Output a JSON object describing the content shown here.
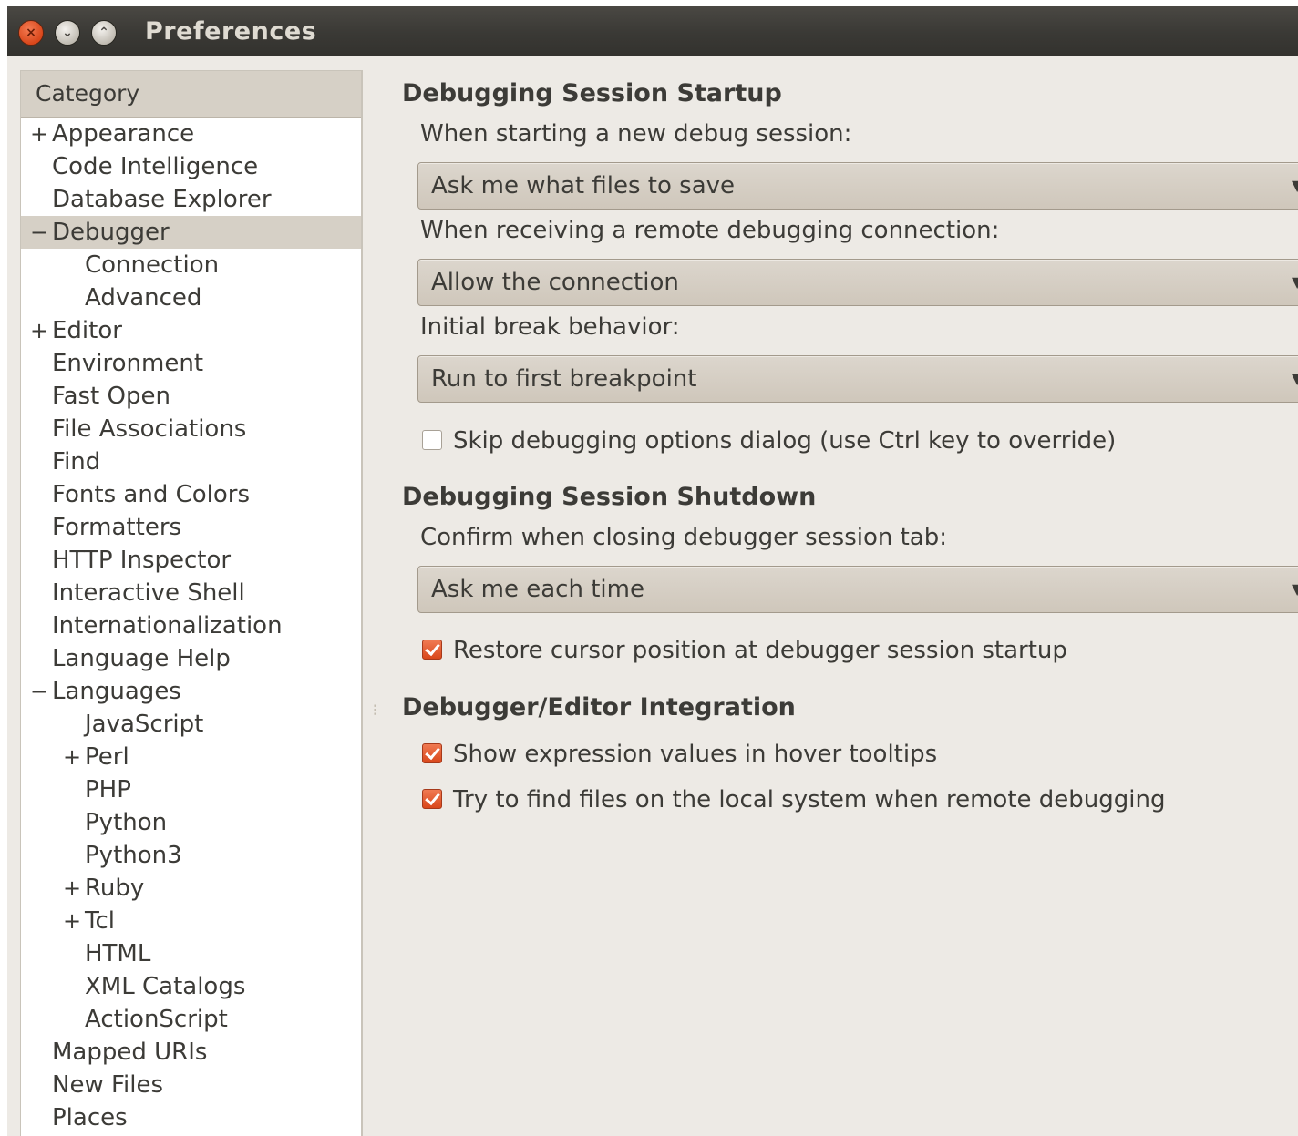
{
  "window": {
    "title": "Preferences",
    "controls": {
      "close": "×",
      "minimize": "⌄",
      "maximize": "⌃"
    }
  },
  "category": {
    "header": "Category",
    "items": [
      {
        "label": "Appearance",
        "expander": "+"
      },
      {
        "label": "Code Intelligence"
      },
      {
        "label": "Database Explorer"
      },
      {
        "label": "Debugger",
        "expander": "−",
        "selected": true
      },
      {
        "label": "Connection"
      },
      {
        "label": "Advanced"
      },
      {
        "label": "Editor",
        "expander": "+"
      },
      {
        "label": "Environment"
      },
      {
        "label": "Fast Open"
      },
      {
        "label": "File Associations"
      },
      {
        "label": "Find"
      },
      {
        "label": "Fonts and Colors"
      },
      {
        "label": "Formatters"
      },
      {
        "label": "HTTP Inspector"
      },
      {
        "label": "Interactive Shell"
      },
      {
        "label": "Internationalization"
      },
      {
        "label": "Language Help"
      },
      {
        "label": "Languages",
        "expander": "−"
      },
      {
        "label": "JavaScript"
      },
      {
        "label": "Perl",
        "expander": "+"
      },
      {
        "label": "PHP"
      },
      {
        "label": "Python"
      },
      {
        "label": "Python3"
      },
      {
        "label": "Ruby",
        "expander": "+"
      },
      {
        "label": "Tcl",
        "expander": "+"
      },
      {
        "label": "HTML"
      },
      {
        "label": "XML Catalogs"
      },
      {
        "label": "ActionScript"
      },
      {
        "label": "Mapped URIs"
      },
      {
        "label": "New Files"
      },
      {
        "label": "Places"
      }
    ]
  },
  "startup": {
    "title": "Debugging Session Startup",
    "new_session_label": "When starting a new debug session:",
    "new_session_value": "Ask me what files to save",
    "remote_label": "When receiving a remote debugging connection:",
    "remote_value": "Allow the connection",
    "break_label": "Initial break behavior:",
    "break_value": "Run to first breakpoint",
    "skip_dialog_label": "Skip debugging options dialog (use Ctrl key to override)",
    "skip_dialog_checked": false
  },
  "shutdown": {
    "title": "Debugging Session Shutdown",
    "confirm_label": "Confirm when closing debugger session tab:",
    "confirm_value": "Ask me each time",
    "restore_cursor_label": "Restore cursor position at debugger session startup",
    "restore_cursor_checked": true
  },
  "integration": {
    "title": "Debugger/Editor Integration",
    "hover_label": "Show expression values in hover tooltips",
    "hover_checked": true,
    "find_files_label": "Try to find files on the local system when remote debugging",
    "find_files_checked": true
  },
  "combo_arrow": "▼",
  "grip_icon": "⠇",
  "colors": {
    "titlebar": "#3a3935",
    "window_bg": "#edeae5",
    "selection": "#d6d0c6",
    "checkbox_on": "#e05a2b"
  }
}
